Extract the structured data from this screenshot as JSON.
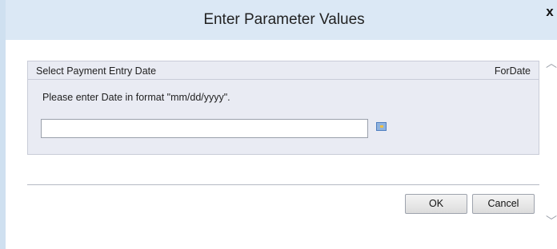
{
  "window": {
    "title": "Enter Parameter Values",
    "close_label": "x"
  },
  "parameter": {
    "prompt": "Select Payment Entry Date",
    "name": "ForDate",
    "hint": "Please enter Date in format \"mm/dd/yyyy\".",
    "value": ""
  },
  "buttons": {
    "ok": "OK",
    "cancel": "Cancel"
  },
  "icons": {
    "calendar": "calendar-icon",
    "scroll_up": "chevron-up-icon",
    "scroll_down": "chevron-down-icon"
  },
  "colors": {
    "titlebar": "#dbe8f5",
    "panel": "#e9ebf3"
  }
}
